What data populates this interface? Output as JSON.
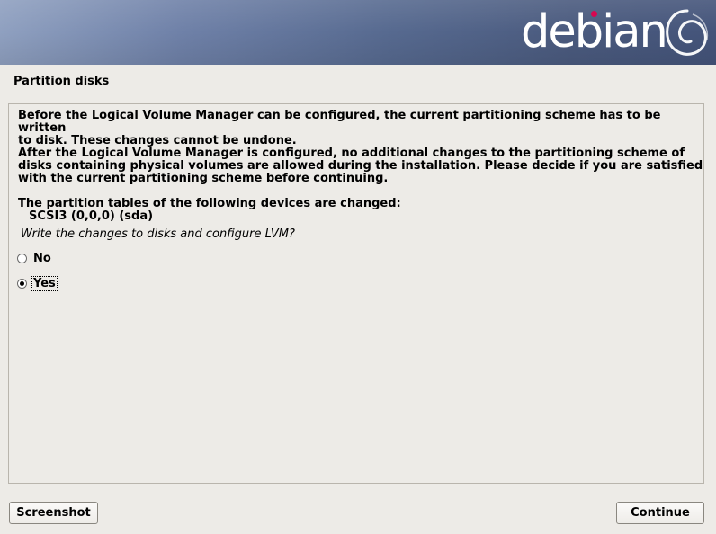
{
  "banner": {
    "logo_text": "debian"
  },
  "dialog": {
    "title": "Partition disks",
    "paragraph1": "Before the Logical Volume Manager can be configured, the current partitioning scheme has to be written\nto disk. These changes cannot be undone.",
    "paragraph2": "After the Logical Volume Manager is configured, no additional changes to the partitioning scheme of\ndisks containing physical volumes are allowed during the installation. Please decide if you are satisfied\nwith the current partitioning scheme before continuing.",
    "paragraph3": "The partition tables of the following devices are changed:",
    "device": "SCSI3 (0,0,0) (sda)",
    "question": "Write the changes to disks and configure LVM?",
    "options": [
      {
        "label": "No",
        "selected": false
      },
      {
        "label": "Yes",
        "selected": true
      }
    ]
  },
  "buttons": {
    "screenshot": "Screenshot",
    "continue": "Continue"
  },
  "colors": {
    "accent_dot": "#d70751",
    "background": "#edebe7"
  }
}
